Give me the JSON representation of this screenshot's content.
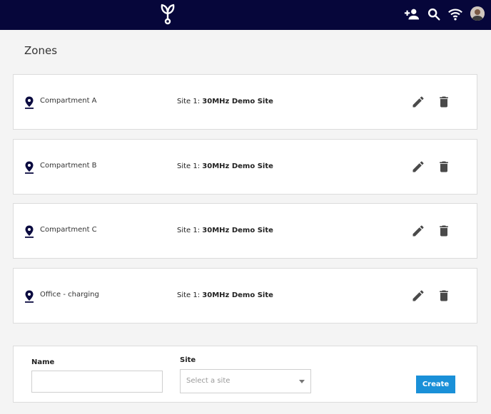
{
  "colors": {
    "topbar_bg": "#06063a",
    "page_bg": "#f4f4f4",
    "card_bg": "#ffffff",
    "accent": "#1a90d8",
    "icon": "#4a4a4a",
    "pin": "#0b0b40"
  },
  "header": {
    "logo_icon": "sprout-logo-icon",
    "icons": [
      "add-user-icon",
      "search-icon",
      "wifi-icon",
      "user-avatar"
    ]
  },
  "page": {
    "title": "Zones"
  },
  "zones": [
    {
      "name": "Compartment A",
      "site_prefix": "Site 1:",
      "site_name": "30MHz Demo Site"
    },
    {
      "name": "Compartment B",
      "site_prefix": "Site 1:",
      "site_name": "30MHz Demo Site"
    },
    {
      "name": "Compartment C",
      "site_prefix": "Site 1:",
      "site_name": "30MHz Demo Site"
    },
    {
      "name": "Office - charging",
      "site_prefix": "Site 1:",
      "site_name": "30MHz Demo Site"
    }
  ],
  "form": {
    "name_label": "Name",
    "name_value": "",
    "site_label": "Site",
    "site_placeholder": "Select a site",
    "create_label": "Create"
  }
}
